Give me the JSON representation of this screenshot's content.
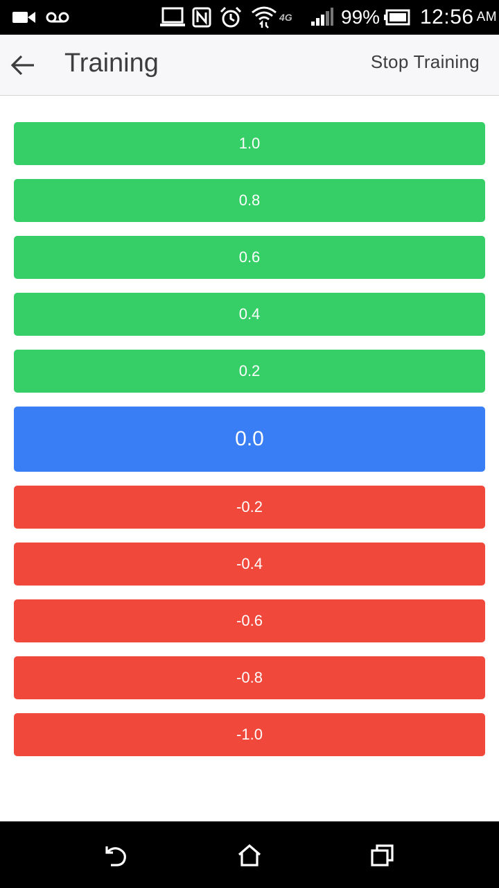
{
  "status_bar": {
    "battery_percent": "99%",
    "time": "12:56",
    "ampm": "AM",
    "network_label": "4G"
  },
  "app_bar": {
    "title": "Training",
    "stop_label": "Stop Training"
  },
  "values": [
    {
      "label": "1.0",
      "type": "pos"
    },
    {
      "label": "0.8",
      "type": "pos"
    },
    {
      "label": "0.6",
      "type": "pos"
    },
    {
      "label": "0.4",
      "type": "pos"
    },
    {
      "label": "0.2",
      "type": "pos"
    },
    {
      "label": "0.0",
      "type": "zero"
    },
    {
      "label": "-0.2",
      "type": "neg"
    },
    {
      "label": "-0.4",
      "type": "neg"
    },
    {
      "label": "-0.6",
      "type": "neg"
    },
    {
      "label": "-0.8",
      "type": "neg"
    },
    {
      "label": "-1.0",
      "type": "neg"
    }
  ],
  "colors": {
    "positive": "#36ce66",
    "zero": "#397ef5",
    "negative": "#f0483b"
  },
  "icons": {
    "status": [
      "video-camera-icon",
      "voicemail-icon",
      "laptop-icon",
      "nfc-icon",
      "alarm-icon",
      "wifi-icon",
      "signal-icon",
      "battery-icon"
    ],
    "nav": [
      "back-nav-icon",
      "home-nav-icon",
      "recents-nav-icon"
    ]
  }
}
